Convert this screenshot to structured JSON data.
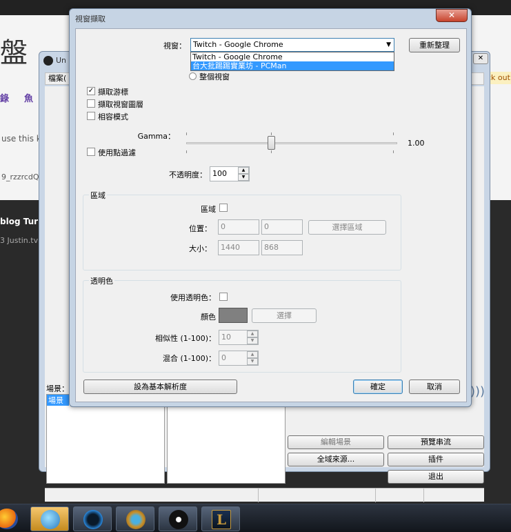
{
  "background_browser": {
    "title_fragment": "盤",
    "nav_items": [
      "錄",
      "魚"
    ],
    "text_line1": "use this ke",
    "text_line2": "9_rzzrcdQF",
    "footer_links": "blog  Tur",
    "footer_text": "3 Justin.tv I",
    "notice": "ck out"
  },
  "obs_window": {
    "title": "Un",
    "menu_first": "檔案(",
    "scenes_label": "場景：",
    "scene_items": [
      "場景"
    ],
    "buttons": {
      "edit_scene": "編輯場景",
      "preview_stream": "預覽串流",
      "global_sources": "全域來源...",
      "plugins": "插件",
      "exit": "退出"
    }
  },
  "dialog": {
    "title": "視窗擷取",
    "close_glyph": "✕",
    "window_label": "視窗：",
    "window_selected": "Twitch - Google Chrome",
    "window_options": [
      "Twitch - Google Chrome",
      "台大批踢踢實業坊 - PCMan"
    ],
    "window_option_selected_index": 1,
    "refresh_button": "重新整理",
    "entire_window_radio": "整個視窗",
    "capture_cursor": {
      "label": "擷取游標",
      "checked": true
    },
    "capture_layered": {
      "label": "擷取視窗圖層",
      "checked": false
    },
    "compat_mode": {
      "label": "相容模式",
      "checked": false
    },
    "gamma_label": "Gamma：",
    "gamma_value": "1.00",
    "point_filter": {
      "label": "使用點過濾",
      "checked": false
    },
    "opacity_label": "不透明度：",
    "opacity_value": "100",
    "region_group": {
      "title": "區域",
      "region_label": "區域",
      "region_checked": false,
      "position_label": "位置：",
      "pos_x": "0",
      "pos_y": "0",
      "select_region_button": "選擇區域",
      "size_label": "大小：",
      "size_w": "1440",
      "size_h": "868"
    },
    "color_key_group": {
      "title": "透明色",
      "use_label": "使用透明色：",
      "use_checked": false,
      "color_label": "顏色",
      "color_value": "#808080",
      "select_button": "選擇",
      "similarity_label": "相似性 (1-100)：",
      "similarity_value": "10",
      "blend_label": "混合 (1-100)：",
      "blend_value": "0"
    },
    "set_base_res_button": "設為基本解析度",
    "ok_button": "確定",
    "cancel_button": "取消"
  },
  "taskbar": {
    "icons": [
      "firefox-icon",
      "messenger-icon",
      "battlenet-icon",
      "hearthstone-icon",
      "obs-icon",
      "league-of-legends-icon"
    ],
    "active_index": 1,
    "league_glyph": "L"
  }
}
